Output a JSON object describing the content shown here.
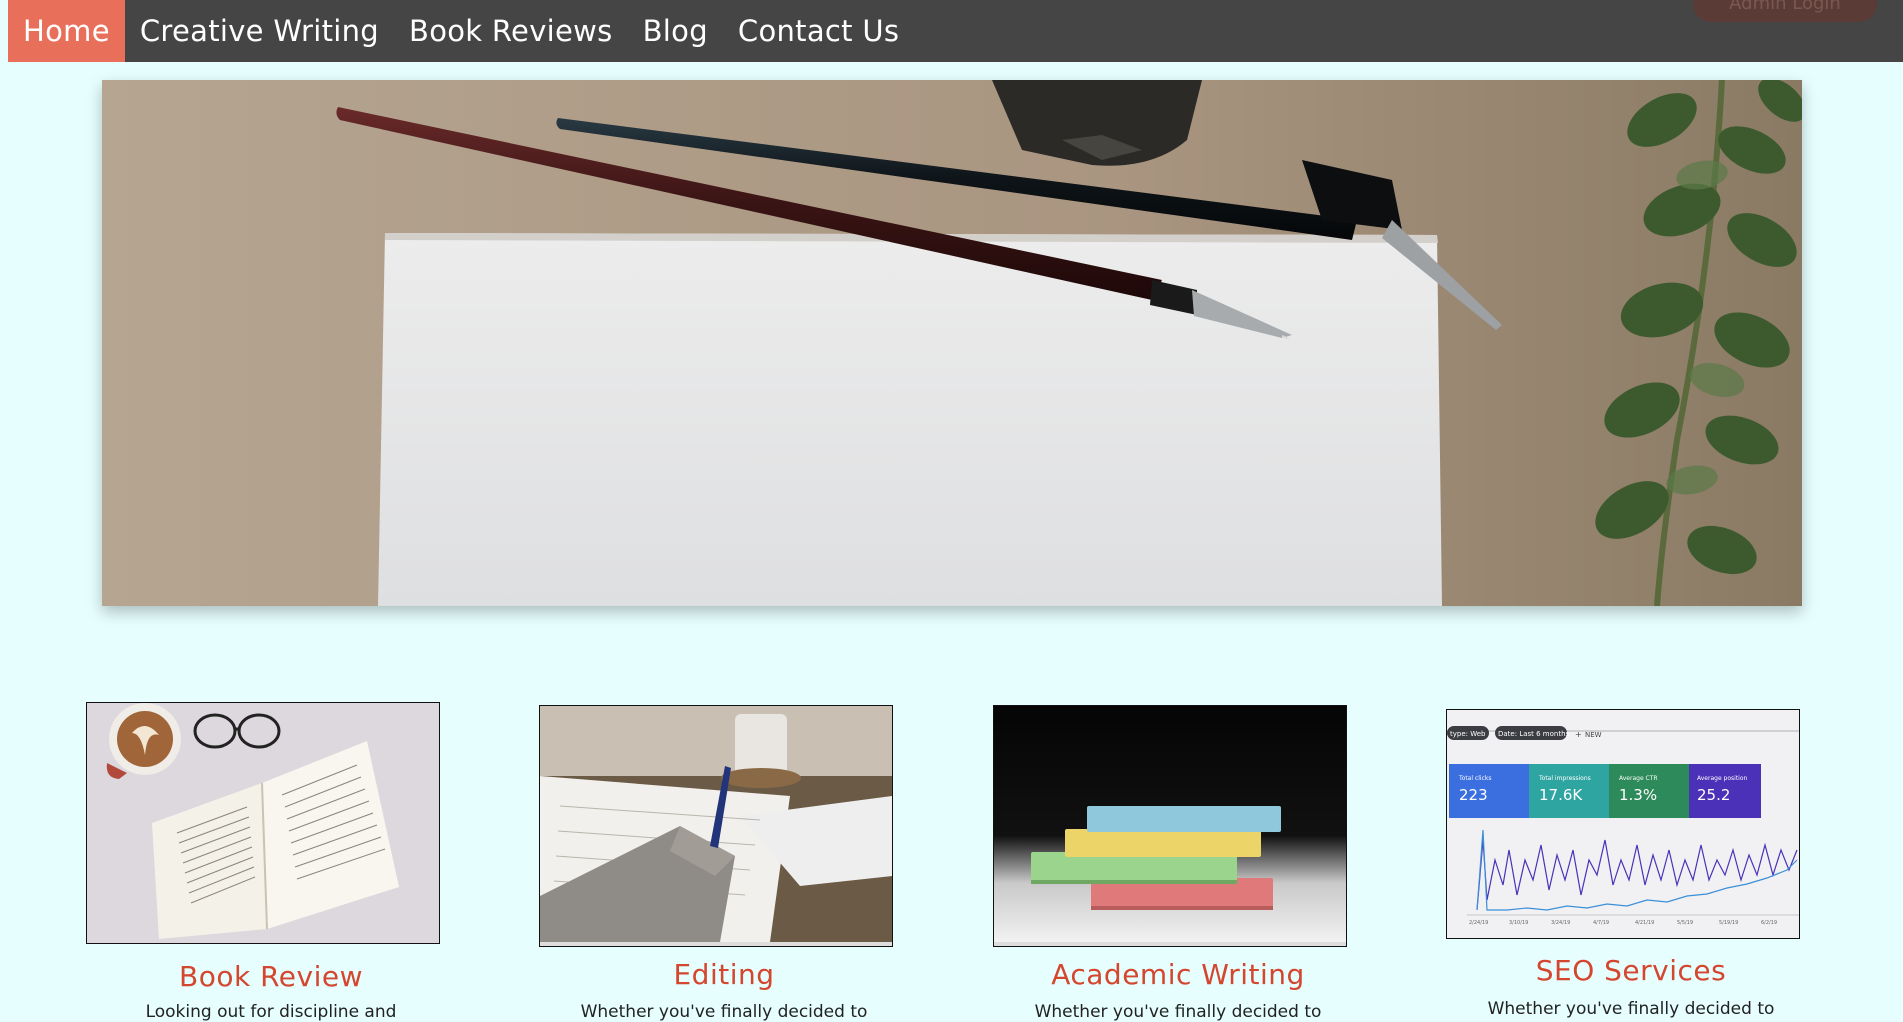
{
  "nav": {
    "items": [
      {
        "label": "Home",
        "active": true
      },
      {
        "label": "Creative Writing",
        "active": false
      },
      {
        "label": "Book Reviews",
        "active": false
      },
      {
        "label": "Blog",
        "active": false
      },
      {
        "label": "Contact Us",
        "active": false
      }
    ],
    "admin_label": "Admin Login"
  },
  "hero": {
    "image": "calligraphy-pens-on-paper"
  },
  "services": [
    {
      "title": "Book Review",
      "text": "Looking out for discipline and",
      "image": "open-book-coffee-glasses"
    },
    {
      "title": "Editing",
      "text": "Whether you've finally decided to",
      "image": "hand-writing-notes"
    },
    {
      "title": "Academic Writing",
      "text": "Whether you've finally decided to",
      "image": "stack-of-books"
    },
    {
      "title": "SEO Services",
      "text": "Whether you've finally decided to",
      "image": "search-console-dashboard",
      "dashboard": {
        "filters": [
          "type: Web",
          "Date: Last 6 months",
          "NEW"
        ],
        "metrics": [
          {
            "label": "Total clicks",
            "value": "223",
            "color": "#3b6fe0"
          },
          {
            "label": "Total impressions",
            "value": "17.6K",
            "color": "#2fa5a2"
          },
          {
            "label": "Average CTR",
            "value": "1.3%",
            "color": "#2d8a5a"
          },
          {
            "label": "Average position",
            "value": "25.2",
            "color": "#4b31b8"
          }
        ],
        "dates": [
          "2/24/19",
          "3/10/19",
          "3/24/19",
          "4/7/19",
          "4/21/19",
          "5/5/19",
          "5/19/19",
          "6/2/19"
        ]
      }
    }
  ],
  "colors": {
    "accent": "#e8705a",
    "nav_bg": "#454545",
    "page_bg": "#e6fefe",
    "title": "#d4462e"
  }
}
